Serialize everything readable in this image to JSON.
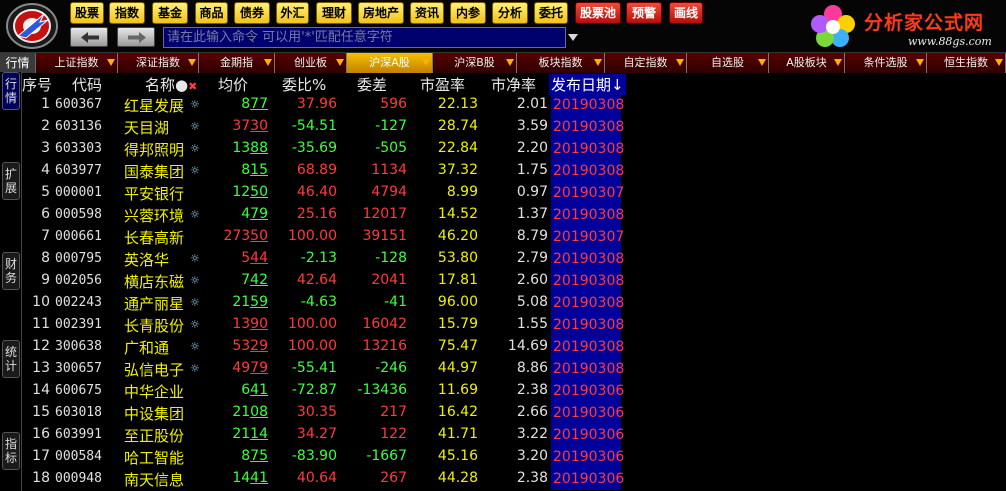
{
  "menu": [
    {
      "label": "股票",
      "style": "gold"
    },
    {
      "label": "指数",
      "style": "gold"
    },
    {
      "label": "基金",
      "style": "gold"
    },
    {
      "label": "商品",
      "style": "gold"
    },
    {
      "label": "债券",
      "style": "gold"
    },
    {
      "label": "外汇",
      "style": "gold"
    },
    {
      "label": "理财",
      "style": "gold"
    },
    {
      "label": "房地产",
      "style": "gold"
    },
    {
      "label": "资讯",
      "style": "gold"
    },
    {
      "label": "内参",
      "style": "gold"
    },
    {
      "label": "分析",
      "style": "gold"
    },
    {
      "label": "委托",
      "style": "gold"
    },
    {
      "label": "股票池",
      "style": "red"
    },
    {
      "label": "预警",
      "style": "red"
    },
    {
      "label": "画线",
      "style": "red"
    }
  ],
  "brand": {
    "name": "分析家公式网",
    "url": "www.88gs.com"
  },
  "command": {
    "placeholder": "请在此输入命令    可以用'*'匹配任意字符"
  },
  "tabs": {
    "hangqing": "行情",
    "items": [
      {
        "label": "上证指数",
        "active": false
      },
      {
        "label": "深证指数",
        "active": false
      },
      {
        "label": "金期指",
        "active": false
      },
      {
        "label": "创业板",
        "active": false
      },
      {
        "label": "沪深A股",
        "active": true
      },
      {
        "label": "沪深B股",
        "active": false
      },
      {
        "label": "板块指数",
        "active": false
      },
      {
        "label": "自定指数",
        "active": false
      },
      {
        "label": "自选股",
        "active": false
      },
      {
        "label": "A股板块",
        "active": false
      },
      {
        "label": "条件选股",
        "active": false
      },
      {
        "label": "恒生指数",
        "active": false
      }
    ]
  },
  "side_tabs": [
    "行情",
    "扩展",
    "财务",
    "统计",
    "指标"
  ],
  "columns": {
    "seq": "序号",
    "code": "代码",
    "name": "名称●",
    "name_mark": "✖",
    "price": "均价",
    "ratio": "委比%",
    "diff": "委差",
    "pe": "市盈率",
    "pb": "市净率",
    "date": "发布日期↓"
  },
  "rows": [
    {
      "seq": "1",
      "code": "600367",
      "name": "红星发展",
      "star": "☼",
      "price_a": "8",
      "price_b": "77",
      "price_color": "green",
      "ratio": "37.96",
      "ratio_color": "red",
      "diff": "596",
      "diff_color": "red",
      "pe": "22.13",
      "pb": "2.01",
      "date": "20190308"
    },
    {
      "seq": "2",
      "code": "603136",
      "name": "天目湖",
      "star": "☼",
      "price_a": "37",
      "price_b": "30",
      "price_color": "red",
      "ratio": "-54.51",
      "ratio_color": "green",
      "diff": "-127",
      "diff_color": "green",
      "pe": "28.74",
      "pb": "3.59",
      "date": "20190308"
    },
    {
      "seq": "3",
      "code": "603303",
      "name": "得邦照明",
      "star": "☼",
      "price_a": "13",
      "price_b": "88",
      "price_color": "green",
      "ratio": "-35.69",
      "ratio_color": "green",
      "diff": "-505",
      "diff_color": "green",
      "pe": "22.84",
      "pb": "2.20",
      "date": "20190308"
    },
    {
      "seq": "4",
      "code": "603977",
      "name": "国泰集团",
      "star": "☼",
      "price_a": "8",
      "price_b": "15",
      "price_color": "green",
      "ratio": "68.89",
      "ratio_color": "red",
      "diff": "1134",
      "diff_color": "red",
      "pe": "37.32",
      "pb": "1.75",
      "date": "20190308"
    },
    {
      "seq": "5",
      "code": "000001",
      "name": "平安银行",
      "star": "",
      "price_a": "12",
      "price_b": "50",
      "price_color": "green",
      "ratio": "46.40",
      "ratio_color": "red",
      "diff": "4794",
      "diff_color": "red",
      "pe": "8.99",
      "pb": "0.97",
      "date": "20190307"
    },
    {
      "seq": "6",
      "code": "000598",
      "name": "兴蓉环境",
      "star": "☼",
      "price_a": "4",
      "price_b": "79",
      "price_color": "green",
      "ratio": "25.16",
      "ratio_color": "red",
      "diff": "12017",
      "diff_color": "red",
      "pe": "14.52",
      "pb": "1.37",
      "date": "20190308"
    },
    {
      "seq": "7",
      "code": "000661",
      "name": "长春高新",
      "star": "",
      "price_a": "273",
      "price_b": "50",
      "price_color": "red",
      "ratio": "100.00",
      "ratio_color": "red",
      "diff": "39151",
      "diff_color": "red",
      "pe": "46.20",
      "pb": "8.79",
      "date": "20190307"
    },
    {
      "seq": "8",
      "code": "000795",
      "name": "英洛华",
      "star": "☼",
      "price_a": "5",
      "price_b": "44",
      "price_color": "red",
      "ratio": "-2.13",
      "ratio_color": "green",
      "diff": "-128",
      "diff_color": "green",
      "pe": "53.80",
      "pb": "2.79",
      "date": "20190308"
    },
    {
      "seq": "9",
      "code": "002056",
      "name": "横店东磁",
      "star": "☼",
      "price_a": "7",
      "price_b": "42",
      "price_color": "green",
      "ratio": "42.64",
      "ratio_color": "red",
      "diff": "2041",
      "diff_color": "red",
      "pe": "17.81",
      "pb": "2.60",
      "date": "20190308"
    },
    {
      "seq": "10",
      "code": "002243",
      "name": "通产丽星",
      "star": "☼",
      "price_a": "21",
      "price_b": "59",
      "price_color": "green",
      "ratio": "-4.63",
      "ratio_color": "green",
      "diff": "-41",
      "diff_color": "green",
      "pe": "96.00",
      "pb": "5.08",
      "date": "20190308"
    },
    {
      "seq": "11",
      "code": "002391",
      "name": "长青股份",
      "star": "☼",
      "price_a": "13",
      "price_b": "90",
      "price_color": "red",
      "ratio": "100.00",
      "ratio_color": "red",
      "diff": "16042",
      "diff_color": "red",
      "pe": "15.79",
      "pb": "1.55",
      "date": "20190308"
    },
    {
      "seq": "12",
      "code": "300638",
      "name": "广和通",
      "star": "☼",
      "price_a": "53",
      "price_b": "29",
      "price_color": "red",
      "ratio": "100.00",
      "ratio_color": "red",
      "diff": "13216",
      "diff_color": "red",
      "pe": "75.47",
      "pb": "14.69",
      "date": "20190308"
    },
    {
      "seq": "13",
      "code": "300657",
      "name": "弘信电子",
      "star": "☼",
      "price_a": "49",
      "price_b": "79",
      "price_color": "red",
      "ratio": "-55.41",
      "ratio_color": "green",
      "diff": "-246",
      "diff_color": "green",
      "pe": "44.97",
      "pb": "8.86",
      "date": "20190308"
    },
    {
      "seq": "14",
      "code": "600675",
      "name": "中华企业",
      "star": "",
      "price_a": "6",
      "price_b": "41",
      "price_color": "green",
      "ratio": "-72.87",
      "ratio_color": "green",
      "diff": "-13436",
      "diff_color": "green",
      "pe": "11.69",
      "pb": "2.38",
      "date": "20190306"
    },
    {
      "seq": "15",
      "code": "603018",
      "name": "中设集团",
      "star": "",
      "price_a": "21",
      "price_b": "08",
      "price_color": "green",
      "ratio": "30.35",
      "ratio_color": "red",
      "diff": "217",
      "diff_color": "red",
      "pe": "16.42",
      "pb": "2.66",
      "date": "20190306"
    },
    {
      "seq": "16",
      "code": "603991",
      "name": "至正股份",
      "star": "",
      "price_a": "21",
      "price_b": "14",
      "price_color": "green",
      "ratio": "34.27",
      "ratio_color": "red",
      "diff": "122",
      "diff_color": "red",
      "pe": "41.71",
      "pb": "3.22",
      "date": "20190306"
    },
    {
      "seq": "17",
      "code": "000584",
      "name": "哈工智能",
      "star": "",
      "price_a": "8",
      "price_b": "75",
      "price_color": "green",
      "ratio": "-83.90",
      "ratio_color": "green",
      "diff": "-1667",
      "diff_color": "green",
      "pe": "45.16",
      "pb": "3.20",
      "date": "20190306"
    },
    {
      "seq": "18",
      "code": "000948",
      "name": "南天信息",
      "star": "",
      "price_a": "14",
      "price_b": "41",
      "price_color": "green",
      "ratio": "40.64",
      "ratio_color": "red",
      "diff": "267",
      "diff_color": "red",
      "pe": "44.28",
      "pb": "2.38",
      "date": "20190306"
    }
  ],
  "colors": {
    "up": "#ff3a3a",
    "down": "#3dff3d",
    "name": "#f0f000",
    "date_bg": "#00009a"
  },
  "icons": {
    "logo": "app-logo-icon",
    "back": "back-arrow-icon",
    "forward": "forward-arrow-icon",
    "dropdown": "dropdown-triangle-icon",
    "brand": "flower-logo-icon",
    "star": "star-mark-icon"
  }
}
